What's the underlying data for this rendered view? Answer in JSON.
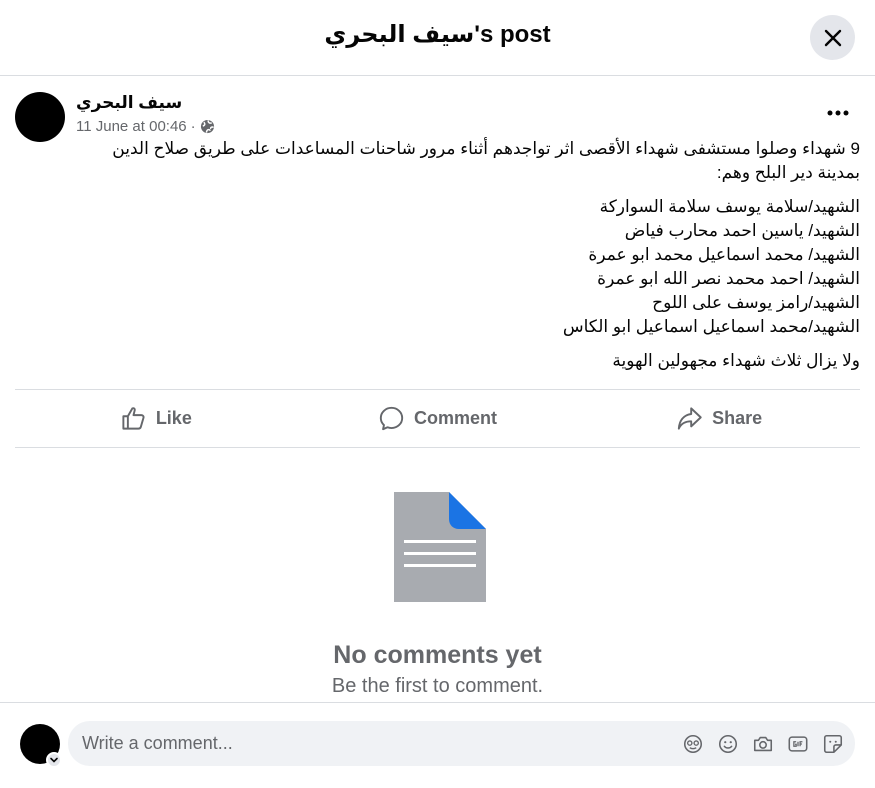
{
  "header": {
    "title": "سيف البحري's post"
  },
  "post": {
    "author": "سيف البحري",
    "timestamp": "11 June at 00:46",
    "separator": "·",
    "intro_line1": "9 شهداء وصلوا مستشفى شهداء الأقصى اثر تواجدهم أثناء مرور شاحنات المساعدات على طريق صلاح الدين",
    "intro_line2": "بمدينة دير البلح وهم:",
    "names": [
      "الشهيد/سلامة يوسف سلامة السواركة",
      "الشهيد/ ياسين احمد محارب فياض",
      "الشهيد/ محمد اسماعيل محمد ابو عمرة",
      "الشهيد/ احمد محمد نصر الله ابو عمرة",
      "الشهيد/رامز يوسف على اللوح",
      "الشهيد/محمد اسماعيل اسماعيل ابو الكاس"
    ],
    "outro": "ولا يزال ثلاث شهداء مجهولين الهوية"
  },
  "actions": {
    "like": "Like",
    "comment": "Comment",
    "share": "Share"
  },
  "empty_state": {
    "title": "No comments yet",
    "subtitle": "Be the first to comment."
  },
  "composer": {
    "placeholder": "Write a comment..."
  },
  "colors": {
    "accent": "#1877f2",
    "muted": "#65676b",
    "divider": "#dadde1",
    "input_bg": "#f0f2f5"
  },
  "icons": [
    "close-icon",
    "globe-icon",
    "more-icon",
    "like-icon",
    "comment-icon",
    "share-icon",
    "document-icon",
    "avatar-icon",
    "chevron-down-icon",
    "avatar-sticker-icon",
    "emoji-icon",
    "camera-icon",
    "gif-icon",
    "sticker-icon"
  ]
}
